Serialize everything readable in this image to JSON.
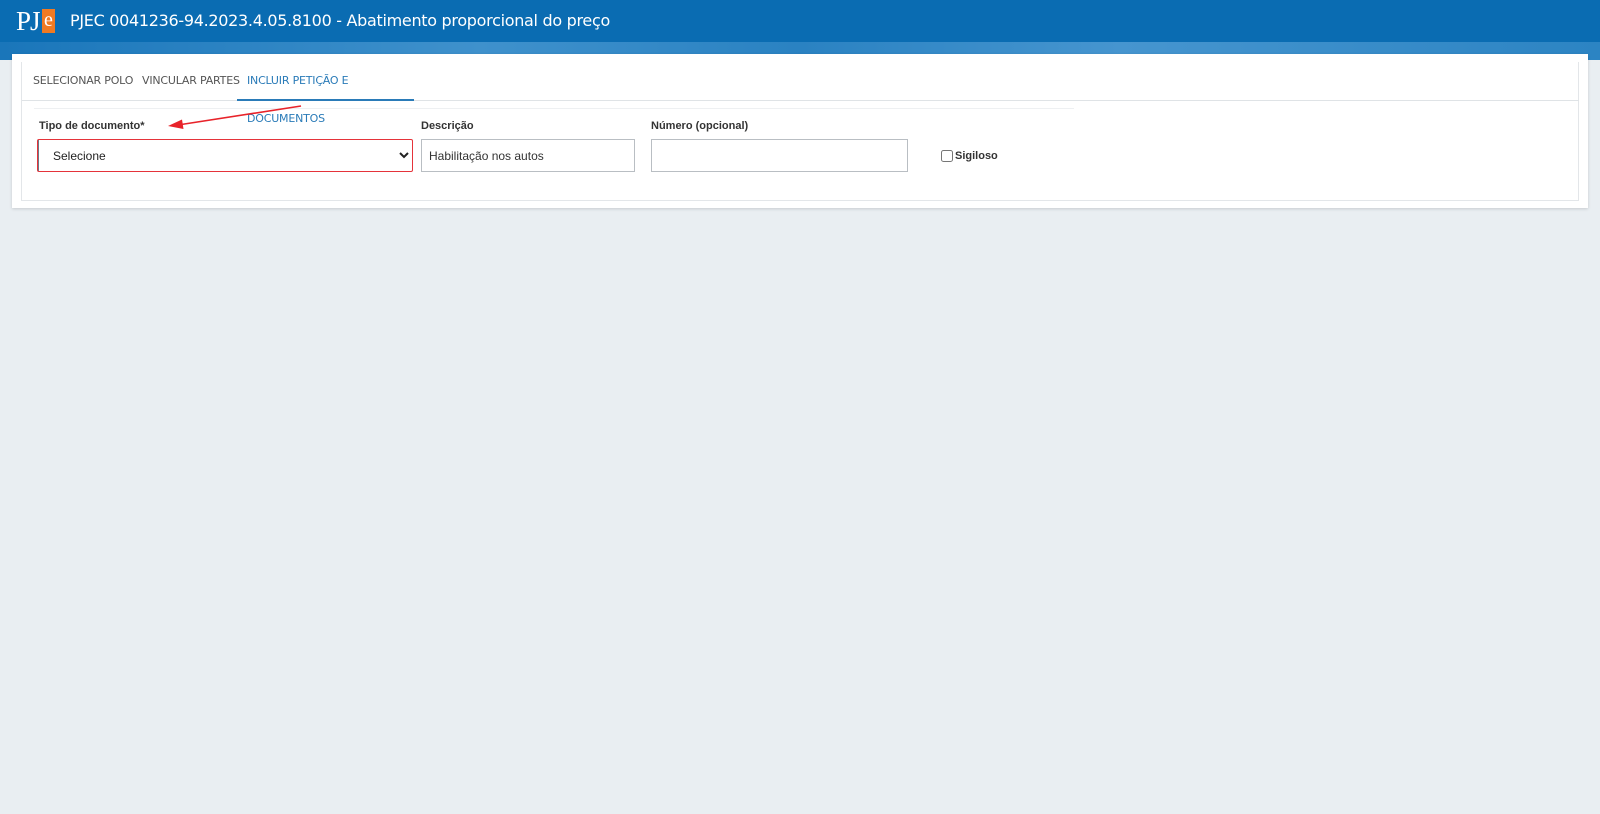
{
  "header": {
    "logo_text": "PJe",
    "logo_letters": {
      "p": "PJ",
      "e": "e"
    },
    "title": "PJEC 0041236-94.2023.4.05.8100 - Abatimento proporcional do preço"
  },
  "tabs": [
    {
      "label": "SELECIONAR POLO",
      "active": false
    },
    {
      "label": "VINCULAR PARTES",
      "active": false
    },
    {
      "label": "INCLUIR PETIÇÃO E DOCUMENTOS",
      "active": true
    }
  ],
  "form": {
    "tipo_documento": {
      "label": "Tipo de documento*",
      "selected": "Selecione"
    },
    "descricao": {
      "label": "Descrição",
      "value": "Habilitação nos autos"
    },
    "numero": {
      "label": "Número (opcional)",
      "value": ""
    },
    "sigiloso": {
      "label": "Sigiloso",
      "checked": false
    }
  },
  "colors": {
    "header": "#0a6cb2",
    "accent": "#2a7bb8",
    "error_border": "#e5333a",
    "annotation_arrow": "#e8232a"
  },
  "icons": [
    "pje-logo-icon",
    "chevron-down-icon",
    "annotation-arrow-icon"
  ]
}
